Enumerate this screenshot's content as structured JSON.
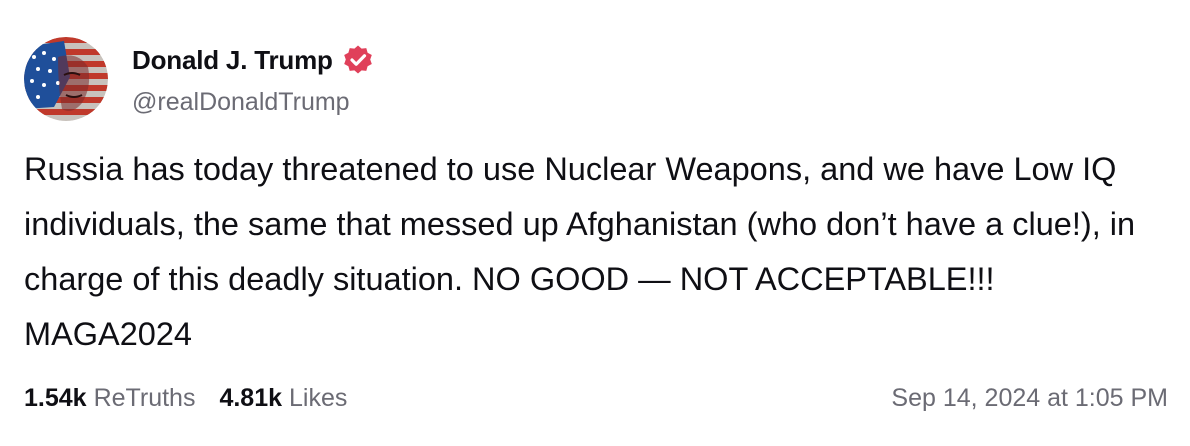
{
  "author": {
    "display_name": "Donald J. Trump",
    "handle": "@realDonaldTrump",
    "verified_icon": "verified-badge-icon",
    "avatar_icon": "profile-avatar"
  },
  "post": {
    "text": "Russia has today threatened to use Nuclear Weapons, and we have Low IQ individuals, the same that messed up Afghanistan (who don’t have a clue!), in charge of this deadly situation. NO GOOD — NOT ACCEPTABLE!!!  MAGA2024"
  },
  "stats": {
    "retruths_count": "1.54k",
    "retruths_label": "ReTruths",
    "likes_count": "4.81k",
    "likes_label": "Likes"
  },
  "timestamp": "Sep 14, 2024 at 1:05 PM",
  "colors": {
    "text": "#0f0f14",
    "muted": "#6b6b74",
    "verified": "#e0405a"
  }
}
